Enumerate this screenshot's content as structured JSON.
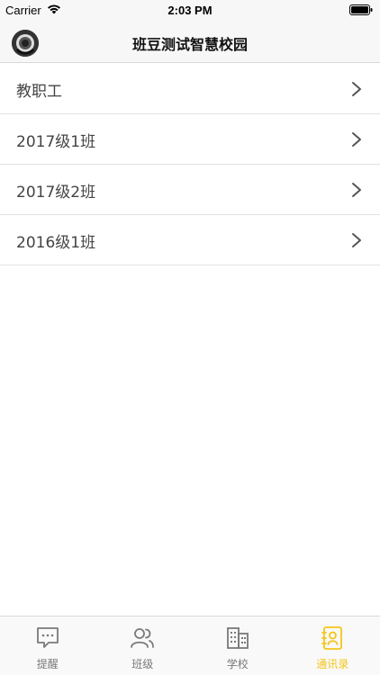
{
  "status_bar": {
    "carrier": "Carrier",
    "time": "2:03 PM"
  },
  "nav": {
    "title": "班豆测试智慧校园"
  },
  "contacts": {
    "groups": [
      {
        "label": "教职工"
      },
      {
        "label": "2017级1班"
      },
      {
        "label": "2017级2班"
      },
      {
        "label": "2016级1班"
      }
    ]
  },
  "tabs": [
    {
      "label": "提醒",
      "icon": "chat-bubble-icon"
    },
    {
      "label": "班级",
      "icon": "people-icon"
    },
    {
      "label": "学校",
      "icon": "building-icon"
    },
    {
      "label": "通讯录",
      "icon": "contacts-book-icon"
    }
  ],
  "colors": {
    "accent": "#f5c518",
    "inactive": "#7a7a7a",
    "bar_background": "#f7f7f7"
  },
  "active_tab": "通讯录"
}
